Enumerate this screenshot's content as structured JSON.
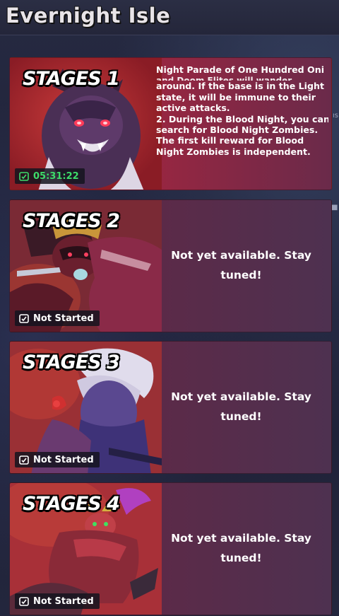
{
  "header": {
    "title": "Evernight Isle"
  },
  "stages": [
    {
      "title": "STAGES 1",
      "status": "05:31:22",
      "status_color": "#3ddc6a",
      "active": true,
      "description_title": "Night Parade of One Hundred Oni",
      "description_lines": [
        "around. If the base is in the Light",
        "state, it will be immune to their",
        "active attacks.",
        "2. During the Blood Night, you can",
        "search for Blood Night Zombies.",
        "The first kill reward for Blood",
        "Night Zombies is independent."
      ]
    },
    {
      "title": "STAGES 2",
      "status": "Not Started",
      "status_color": "#ffffff",
      "active": false,
      "message": "Not yet available. Stay tuned!"
    },
    {
      "title": "STAGES 3",
      "status": "Not Started",
      "status_color": "#ffffff",
      "active": false,
      "message": "Not yet available. Stay tuned!"
    },
    {
      "title": "STAGES 4",
      "status": "Not Started",
      "status_color": "#ffffff",
      "active": false,
      "message": "Not yet available. Stay tuned!"
    }
  ],
  "icons": {
    "timer": "clock-icon",
    "stage1_art": "oni-wolf-icon",
    "stage2_art": "samurai-oni-icon",
    "stage3_art": "white-haired-oni-icon",
    "stage4_art": "fox-rider-oni-icon"
  },
  "colors": {
    "active_card": "#b42a2a",
    "inactive_card": "#5a2436",
    "timer_green": "#3ddc6a"
  }
}
